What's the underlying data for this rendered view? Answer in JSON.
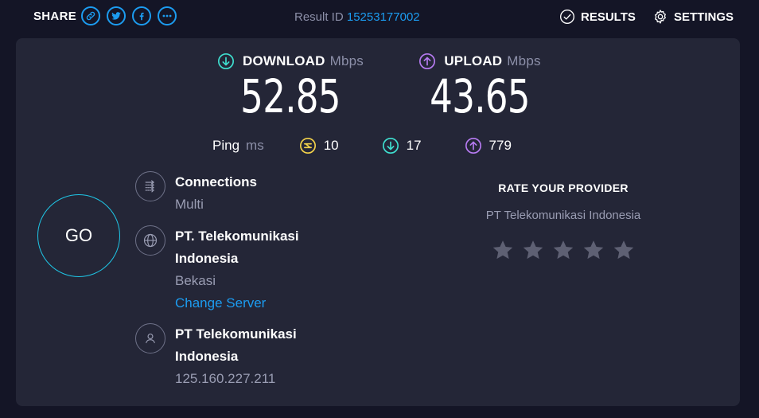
{
  "header": {
    "share_label": "SHARE",
    "share_icons": [
      "link-icon",
      "twitter-icon",
      "facebook-icon",
      "more-icon"
    ],
    "result_id_label": "Result ID",
    "result_id_value": "15253177002",
    "results_label": "RESULTS",
    "settings_label": "SETTINGS"
  },
  "download": {
    "label": "DOWNLOAD",
    "unit": "Mbps",
    "value": "52.85",
    "color": "#3fe0d0"
  },
  "upload": {
    "label": "UPLOAD",
    "unit": "Mbps",
    "value": "43.65",
    "color": "#b77bf2"
  },
  "ping": {
    "label": "Ping",
    "unit": "ms",
    "idle": "10",
    "download": "17",
    "upload": "779",
    "idle_color": "#f3d24a"
  },
  "go_label": "GO",
  "connections": {
    "title": "Connections",
    "value": "Multi"
  },
  "server": {
    "title": "PT. Telekomunikasi Indonesia",
    "location": "Bekasi",
    "change_label": "Change Server"
  },
  "isp": {
    "title": "PT Telekomunikasi Indonesia",
    "ip": "125.160.227.211"
  },
  "rate": {
    "title": "RATE YOUR PROVIDER",
    "provider": "PT Telekomunikasi Indonesia",
    "star_count": 5
  },
  "colors": {
    "accent": "#1c9cf0",
    "background": "#141526",
    "panel": "#242637"
  }
}
